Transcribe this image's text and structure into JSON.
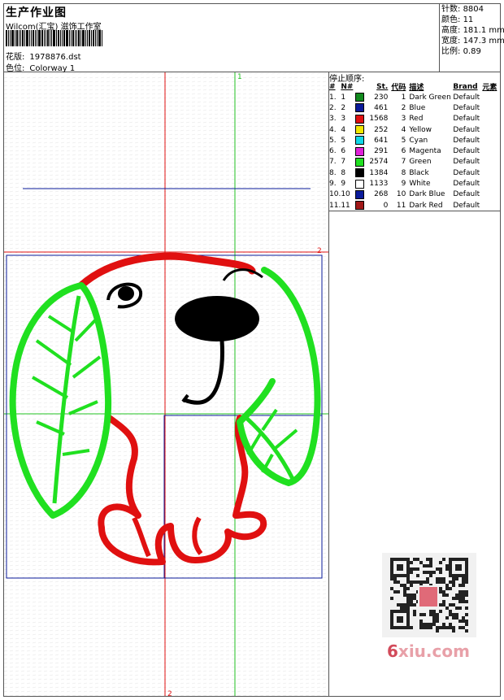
{
  "header": {
    "title": "生产作业图",
    "company": "Wilcom(汇宝) 滋饰工作室",
    "design_label": "花版:",
    "design_value": "1978876.dst",
    "color_label": "色位:",
    "color_value": "Colorway 1"
  },
  "stats": [
    {
      "label": "针数:",
      "value": "8804"
    },
    {
      "label": "颜色:",
      "value": "11"
    },
    {
      "label": "高度:",
      "value": "181.1 mm"
    },
    {
      "label": "宽度:",
      "value": "147.3 mm"
    },
    {
      "label": "比例:",
      "value": "0.89"
    }
  ],
  "guides": {
    "v1_label": "1",
    "v2_label": "2",
    "h2_label": "2"
  },
  "stop_sequence": {
    "title": "停止顺序:",
    "columns": [
      "#",
      "N#",
      "",
      "St.",
      "代码",
      "描述",
      "Brand",
      "元素"
    ],
    "rows": [
      {
        "idx": "1.",
        "n": "1",
        "color": "#118a1e",
        "st": "230",
        "code": "1",
        "desc": "Dark Green",
        "brand": "Default"
      },
      {
        "idx": "2.",
        "n": "2",
        "color": "#0a1a9a",
        "st": "461",
        "code": "2",
        "desc": "Blue",
        "brand": "Default"
      },
      {
        "idx": "3.",
        "n": "3",
        "color": "#e01010",
        "st": "1568",
        "code": "3",
        "desc": "Red",
        "brand": "Default"
      },
      {
        "idx": "4.",
        "n": "4",
        "color": "#f0e800",
        "st": "252",
        "code": "4",
        "desc": "Yellow",
        "brand": "Default"
      },
      {
        "idx": "5.",
        "n": "5",
        "color": "#10d8e8",
        "st": "641",
        "code": "5",
        "desc": "Cyan",
        "brand": "Default"
      },
      {
        "idx": "6.",
        "n": "6",
        "color": "#e020d8",
        "st": "291",
        "code": "6",
        "desc": "Magenta",
        "brand": "Default"
      },
      {
        "idx": "7.",
        "n": "7",
        "color": "#20e020",
        "st": "2574",
        "code": "7",
        "desc": "Green",
        "brand": "Default"
      },
      {
        "idx": "8.",
        "n": "8",
        "color": "#000000",
        "st": "1384",
        "code": "8",
        "desc": "Black",
        "brand": "Default"
      },
      {
        "idx": "9.",
        "n": "9",
        "color": "#ffffff",
        "st": "1133",
        "code": "9",
        "desc": "White",
        "brand": "Default"
      },
      {
        "idx": "10.",
        "n": "10",
        "color": "#0a1a9a",
        "st": "268",
        "code": "10",
        "desc": "Dark Blue",
        "brand": "Default"
      },
      {
        "idx": "11.",
        "n": "11",
        "color": "#a01818",
        "st": "0",
        "code": "11",
        "desc": "Dark Red",
        "brand": "Default"
      }
    ]
  },
  "watermark": {
    "prefix": "6",
    "rest": "xiu.com"
  }
}
